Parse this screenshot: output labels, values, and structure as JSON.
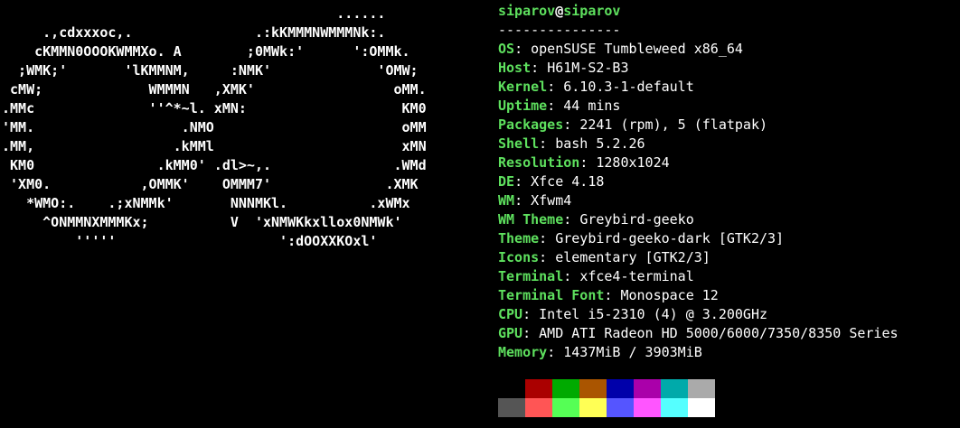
{
  "logo": {
    "lines": [
      "                                         ......",
      "     .,cdxxxoc,.               .:kKMMMNWMMMNk:.",
      "    cKMMN0OOOKWMMXo. A        ;0MWk:'      ':OMMk.",
      "  ;WMK;'       'lKMMNM,     :NMK'             'OMW;",
      " cMW;             WMMMN   ,XMK'                 oMM.",
      ".MMc              ''^*~l. xMN:                   KM0",
      "'MM.                  .NMO                       oMM",
      ".MM,                 .kMMl                       xMN",
      " KM0               .kMM0' .dl>~,.               .WMd",
      " 'XM0.           ,OMMK'    OMMM7'              .XMK",
      "   *WMO:.    .;xNMMk'       NNNMKl.          .xWMx",
      "     ^ONMMNXMMMKx;          V  'xNMWKkxllox0NMWk'",
      "         '''''                    ':dOOXXKOxl'"
    ]
  },
  "header": {
    "user": "siparov",
    "at": "@",
    "host": "siparov",
    "separator": "---------------"
  },
  "info": [
    {
      "key": "OS",
      "value": "openSUSE Tumbleweed x86_64"
    },
    {
      "key": "Host",
      "value": "H61M-S2-B3"
    },
    {
      "key": "Kernel",
      "value": "6.10.3-1-default"
    },
    {
      "key": "Uptime",
      "value": "44 mins"
    },
    {
      "key": "Packages",
      "value": "2241 (rpm), 5 (flatpak)"
    },
    {
      "key": "Shell",
      "value": "bash 5.2.26"
    },
    {
      "key": "Resolution",
      "value": "1280x1024"
    },
    {
      "key": "DE",
      "value": "Xfce 4.18"
    },
    {
      "key": "WM",
      "value": "Xfwm4"
    },
    {
      "key": "WM Theme",
      "value": "Greybird-geeko"
    },
    {
      "key": "Theme",
      "value": "Greybird-geeko-dark [GTK2/3]"
    },
    {
      "key": "Icons",
      "value": "elementary [GTK2/3]"
    },
    {
      "key": "Terminal",
      "value": "xfce4-terminal"
    },
    {
      "key": "Terminal Font",
      "value": "Monospace 12"
    },
    {
      "key": "CPU",
      "value": "Intel i5-2310 (4) @ 3.200GHz"
    },
    {
      "key": "GPU",
      "value": "AMD ATI Radeon HD 5000/6000/7350/8350 Series"
    },
    {
      "key": "Memory",
      "value": "1437MiB / 3903MiB"
    }
  ],
  "key_suffix": ": ",
  "palette": {
    "normal": [
      "#000000",
      "#aa0000",
      "#00aa00",
      "#aa5500",
      "#0000aa",
      "#aa00aa",
      "#00aaaa",
      "#aaaaaa"
    ],
    "bright": [
      "#555555",
      "#ff5555",
      "#55ff55",
      "#ffff55",
      "#5555ff",
      "#ff55ff",
      "#55ffff",
      "#ffffff"
    ]
  }
}
